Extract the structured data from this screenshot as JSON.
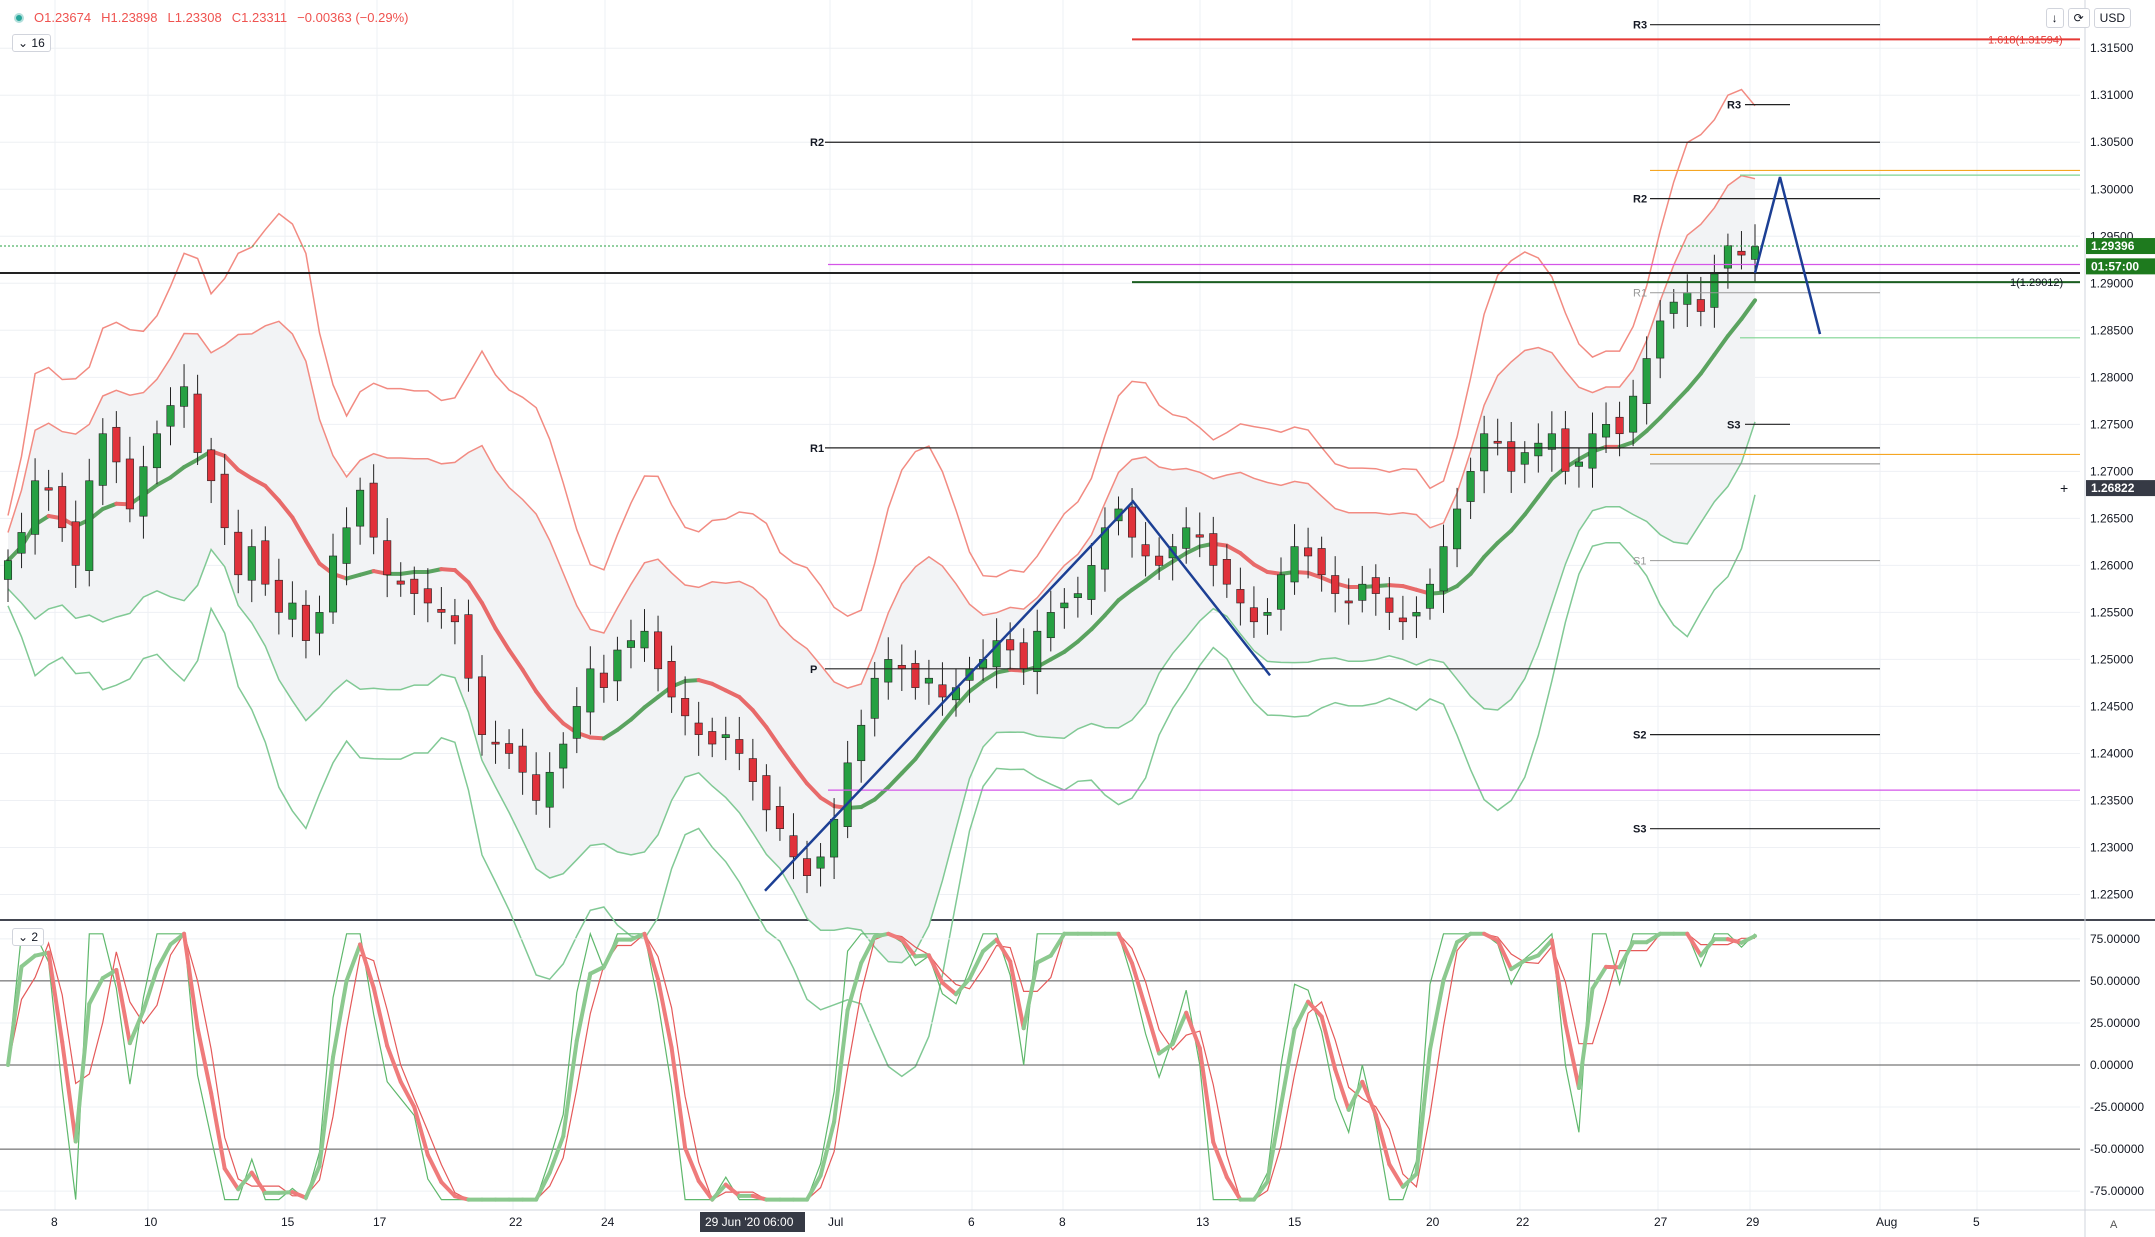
{
  "header": {
    "open": "O1.23674",
    "high": "H1.23898",
    "low": "L1.23308",
    "close": "C1.23311",
    "change": "−0.00363 (−0.29%)",
    "interval_chip": "16",
    "osc_chip": "2",
    "currency": "USD",
    "btn_down": "↓",
    "btn_refresh": "⟳"
  },
  "price_axis": {
    "ticks": [
      "1.31500",
      "1.31000",
      "1.30500",
      "1.30000",
      "1.29500",
      "1.29000",
      "1.28500",
      "1.28000",
      "1.27500",
      "1.27000",
      "1.26500",
      "1.26000",
      "1.25500",
      "1.25000",
      "1.24500",
      "1.24000",
      "1.23500",
      "1.23000",
      "1.22500"
    ],
    "last_price": "1.29396",
    "countdown": "01:57:00",
    "cursor_price": "1.26822"
  },
  "osc_axis": {
    "ticks": [
      "75.00000",
      "50.00000",
      "25.00000",
      "0.00000",
      "-25.00000",
      "-50.00000",
      "-75.00000"
    ]
  },
  "time_axis": {
    "ticks": [
      "8",
      "10",
      "15",
      "17",
      "22",
      "24",
      "29 Jun '20  06:00",
      "Jul",
      "6",
      "8",
      "13",
      "15",
      "20",
      "22",
      "27",
      "29",
      "Aug",
      "5"
    ]
  },
  "pivots": {
    "daily": [
      "R3",
      "R2",
      "R1",
      "S1",
      "S3"
    ],
    "weekly": [
      "R3",
      "R2",
      "R1",
      "P",
      "S1",
      "S2",
      "S3"
    ]
  },
  "fib_label": "1.618(1.31594)",
  "fib_label2": "1(1.29012)",
  "colors": {
    "bull": "#26a042",
    "bear": "#e0323b",
    "band_red": "#f28b82",
    "band_green": "#81c995",
    "zigzag": "#1c3f94",
    "fib_red": "#e53935",
    "fib_green": "#1b5e20",
    "magenta": "#d455e8",
    "orange": "#f5a623"
  },
  "chart_data": {
    "type": "candlestick",
    "symbol_pair_hint": "",
    "ylim": [
      1.2225,
      1.318
    ],
    "last": 1.29396,
    "closes": [
      1.2605,
      1.2635,
      1.269,
      1.268,
      1.264,
      1.26,
      1.269,
      1.274,
      1.271,
      1.266,
      1.2705,
      1.274,
      1.277,
      1.279,
      1.272,
      1.269,
      1.264,
      1.259,
      1.262,
      1.258,
      1.255,
      1.256,
      1.252,
      1.255,
      1.261,
      1.264,
      1.268,
      1.263,
      1.259,
      1.258,
      1.257,
      1.256,
      1.255,
      1.254,
      1.248,
      1.242,
      1.241,
      1.24,
      1.238,
      1.235,
      1.238,
      1.241,
      1.245,
      1.249,
      1.247,
      1.251,
      1.252,
      1.253,
      1.249,
      1.246,
      1.244,
      1.242,
      1.241,
      1.242,
      1.24,
      1.237,
      1.234,
      1.232,
      1.229,
      1.227,
      1.229,
      1.233,
      1.239,
      1.243,
      1.248,
      1.25,
      1.249,
      1.247,
      1.248,
      1.246,
      1.247,
      1.249,
      1.25,
      1.252,
      1.251,
      1.249,
      1.253,
      1.255,
      1.256,
      1.257,
      1.26,
      1.264,
      1.266,
      1.263,
      1.261,
      1.26,
      1.262,
      1.264,
      1.263,
      1.26,
      1.258,
      1.256,
      1.254,
      1.255,
      1.259,
      1.262,
      1.261,
      1.259,
      1.257,
      1.256,
      1.258,
      1.257,
      1.255,
      1.254,
      1.255,
      1.258,
      1.262,
      1.266,
      1.27,
      1.274,
      1.273,
      1.27,
      1.272,
      1.273,
      1.274,
      1.27,
      1.271,
      1.274,
      1.275,
      1.274,
      1.278,
      1.282,
      1.286,
      1.288,
      1.289,
      1.287,
      1.291,
      1.294,
      1.293,
      1.2939
    ],
    "oscillator": {
      "ylim": [
        -85,
        85
      ],
      "levels": [
        50,
        0,
        -50
      ]
    },
    "pivot_levels": {
      "R3_week": 1.3175,
      "R2_week": 1.305,
      "R1_week": 1.2725,
      "P_week": 1.249,
      "S2_week": 1.242,
      "S3_week": 1.232,
      "R3_day": 1.309,
      "R2_day": 1.299,
      "R1_day": 1.289,
      "S1_day": 1.2605,
      "S3_day": 1.275
    },
    "fib": {
      "level_1618": 1.31594,
      "level_1": 1.29012
    }
  }
}
